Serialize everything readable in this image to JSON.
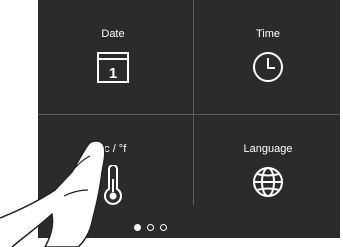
{
  "tiles": [
    {
      "id": "date",
      "label": "Date",
      "icon": "calendar-icon",
      "icon_text": "1"
    },
    {
      "id": "time",
      "label": "Time",
      "icon": "clock-icon"
    },
    {
      "id": "units",
      "label": "°c / °f",
      "icon": "thermometer-icon"
    },
    {
      "id": "language",
      "label": "Language",
      "icon": "globe-icon"
    }
  ],
  "pagination": {
    "pages": 3,
    "current": 1
  },
  "colors": {
    "screen_bg": "#2b2b2b",
    "divider": "#5a5a5a",
    "foreground": "#ffffff"
  }
}
